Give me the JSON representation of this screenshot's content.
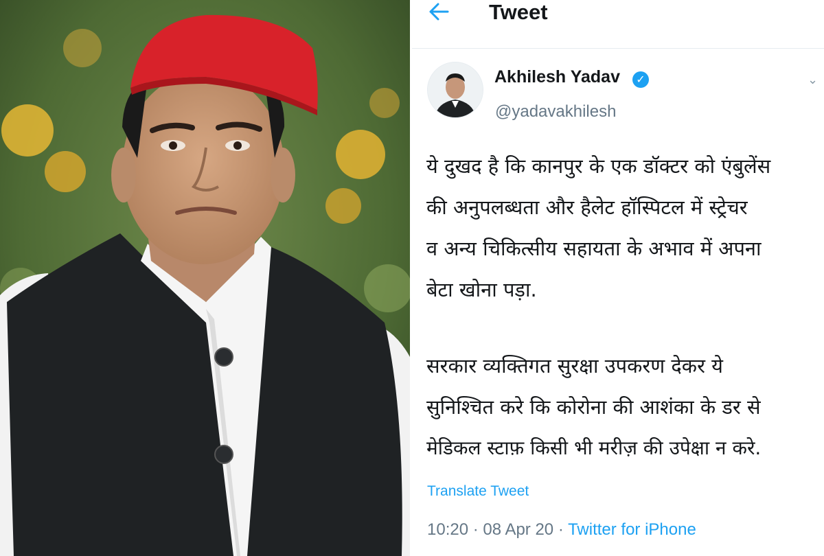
{
  "header": {
    "title": "Tweet",
    "back_icon": "arrow-left-icon"
  },
  "author": {
    "name": "Akhilesh Yadav",
    "handle": "@yadavakhilesh",
    "verified_icon": "verified-badge-icon"
  },
  "tweet": {
    "lines": [
      "ये दुखद है कि कानपुर के एक डॉक्टर को एंबुलेंस",
      "की अनुपलब्धता और हैलेट हॉस्पिटल में स्ट्रेचर",
      "व अन्य चिकित्सीय सहायता के अभाव में अपना",
      "बेटा खोना पड़ा.",
      "सरकार व्यक्तिगत सुरक्षा उपकरण देकर ये",
      "सुनिश्चित करे कि कोरोना की आशंका के डर से",
      "मेडिकल स्टाफ़ किसी भी मरीज़ की उपेक्षा न करे."
    ],
    "translate_label": "Translate Tweet",
    "time": "10:20",
    "date": "08 Apr 20",
    "source": "Twitter for iPhone",
    "separator": "·"
  },
  "colors": {
    "accent": "#1da1f2",
    "cap": "#d8222a",
    "jacket": "#1e2124"
  }
}
